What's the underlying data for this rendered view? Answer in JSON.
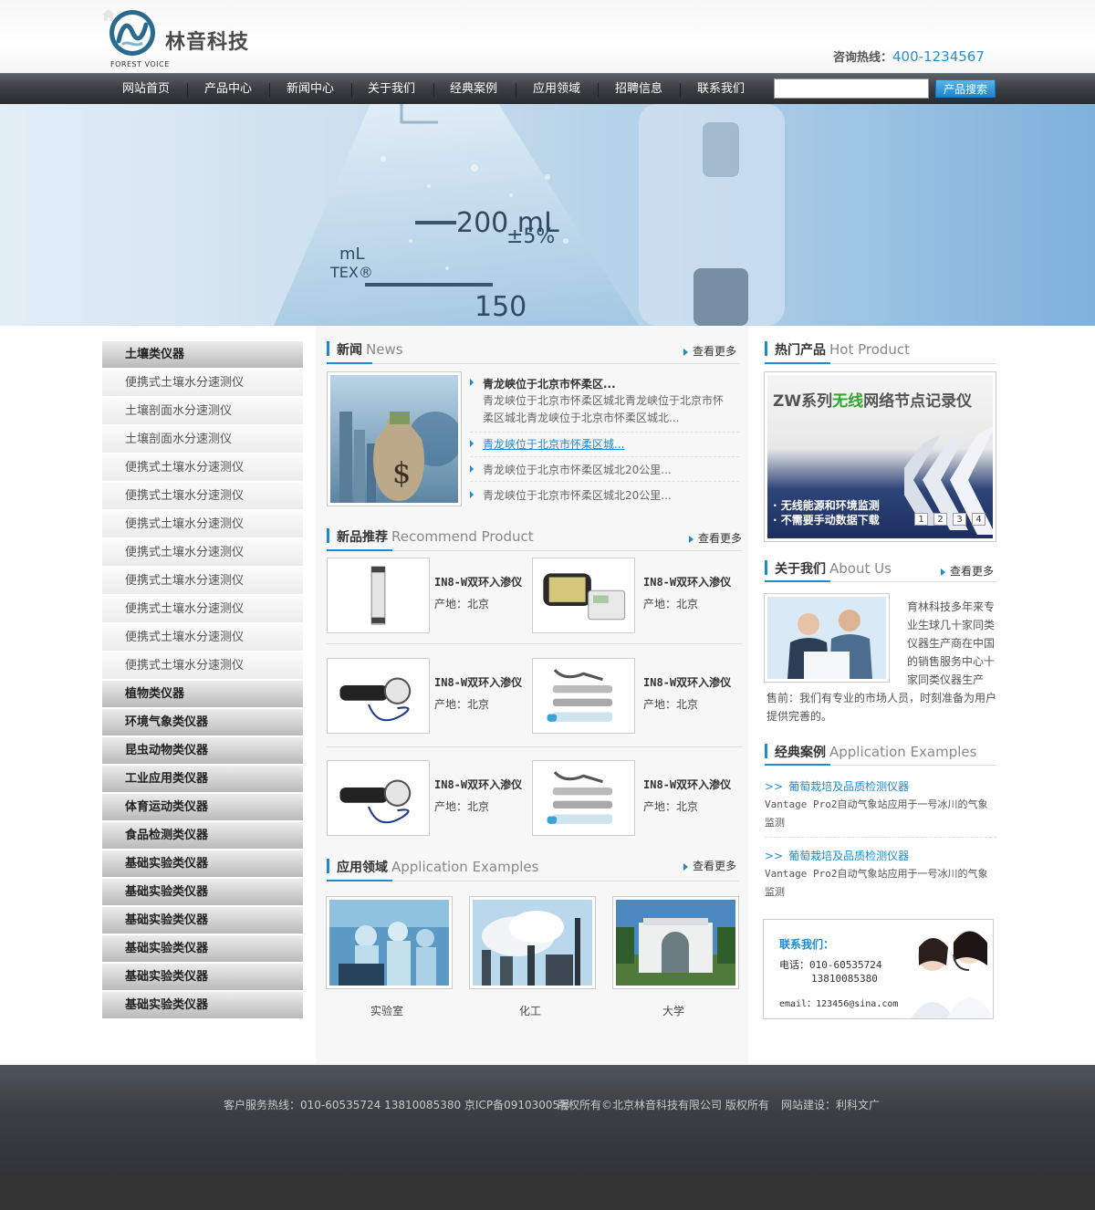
{
  "header": {
    "logo_text": "林音科技",
    "logo_sub": "FOREST VOICE",
    "hotline_label": "咨询热线：",
    "hotline_number": "400-1234567"
  },
  "nav": {
    "items": [
      "网站首页",
      "产品中心",
      "新闻中心",
      "关于我们",
      "经典案例",
      "应用领域",
      "招聘信息",
      "联系我们"
    ],
    "search_value": "",
    "search_button": "产品搜索"
  },
  "sidebar": {
    "categories": [
      {
        "label": "土壤类仪器",
        "type": "head"
      },
      {
        "label": "便携式土壤水分速测仪",
        "type": "sub"
      },
      {
        "label": "土壤剖面水分速测仪",
        "type": "sub"
      },
      {
        "label": "土壤剖面水分速测仪",
        "type": "sub"
      },
      {
        "label": "便携式土壤水分速测仪",
        "type": "sub"
      },
      {
        "label": "便携式土壤水分速测仪",
        "type": "sub"
      },
      {
        "label": "便携式土壤水分速测仪",
        "type": "sub"
      },
      {
        "label": "便携式土壤水分速测仪",
        "type": "sub"
      },
      {
        "label": "便携式土壤水分速测仪",
        "type": "sub"
      },
      {
        "label": "便携式土壤水分速测仪",
        "type": "sub"
      },
      {
        "label": "便携式土壤水分速测仪",
        "type": "sub"
      },
      {
        "label": "便携式土壤水分速测仪",
        "type": "sub"
      },
      {
        "label": "植物类仪器",
        "type": "head"
      },
      {
        "label": "环境气象类仪器",
        "type": "head"
      },
      {
        "label": "昆虫动物类仪器",
        "type": "head"
      },
      {
        "label": "工业应用类仪器",
        "type": "head"
      },
      {
        "label": "体育运动类仪器",
        "type": "head"
      },
      {
        "label": "食品检测类仪器",
        "type": "head"
      },
      {
        "label": "基础实验类仪器",
        "type": "head"
      },
      {
        "label": "基础实验类仪器",
        "type": "head"
      },
      {
        "label": "基础实验类仪器",
        "type": "head"
      },
      {
        "label": "基础实验类仪器",
        "type": "head"
      },
      {
        "label": "基础实验类仪器",
        "type": "head"
      },
      {
        "label": "基础实验类仪器",
        "type": "head"
      }
    ]
  },
  "news": {
    "title": "新闻",
    "title_en": "News",
    "more": "查看更多",
    "featured_title": "青龙峡位于北京市怀柔区...",
    "featured_desc": "青龙峡位于北京市怀柔区城北青龙峡位于北京市怀柔区城北青龙峡位于北京市怀柔区城北...",
    "items": [
      "青龙峡位于北京市怀柔区城...",
      "青龙峡位于北京市怀柔区城北20公里...",
      "青龙峡位于北京市怀柔区城北20公里..."
    ]
  },
  "recommend": {
    "title": "新品推荐",
    "title_en": "Recommend Product",
    "more": "查看更多",
    "products": [
      {
        "name": "IN8-W双环入渗仪",
        "origin": "产地：北京"
      },
      {
        "name": "IN8-W双环入渗仪",
        "origin": "产地：北京"
      },
      {
        "name": "IN8-W双环入渗仪",
        "origin": "产地：北京"
      },
      {
        "name": "IN8-W双环入渗仪",
        "origin": "产地：北京"
      },
      {
        "name": "IN8-W双环入渗仪",
        "origin": "产地：北京"
      },
      {
        "name": "IN8-W双环入渗仪",
        "origin": "产地：北京"
      }
    ]
  },
  "application": {
    "title": "应用领域",
    "title_en": "Application Examples",
    "more": "查看更多",
    "items": [
      "实验室",
      "化工",
      "大学"
    ]
  },
  "hot": {
    "title": "热门产品",
    "title_en": "Hot Product",
    "banner_title_pre": "ZW系列",
    "banner_title_hi": "无线",
    "banner_title_post": "网络节点记录仪",
    "banner_line1": "· 无线能源和环境监测",
    "banner_line2": "· 不需要手动数据下载",
    "pages": [
      "1",
      "2",
      "3",
      "4"
    ]
  },
  "about": {
    "title": "关于我们",
    "title_en": "About Us",
    "more": "查看更多",
    "text_right": "育林科技多年来专业生球几十家同类仪器生产商在中国的销售服务中心十家同类仪器生产",
    "text_full": "售前：我们有专业的市场人员，时刻准备为用户提供完善的。"
  },
  "cases": {
    "title": "经典案例",
    "title_en": "Application Examples",
    "items": [
      {
        "title": "葡萄栽培及品质检测仪器",
        "desc": "Vantage Pro2自动气象站应用于一号冰川的气象监测"
      },
      {
        "title": "葡萄栽培及品质检测仪器",
        "desc": "Vantage Pro2自动气象站应用于一号冰川的气象监测"
      }
    ]
  },
  "contact": {
    "title": "联系我们：",
    "phone_label": "电话：",
    "phone1": "010-60535724",
    "phone2": "13810085380",
    "email": "email：123456@sina.com"
  },
  "footer": {
    "service": "客户服务热线：010-60535724  13810085380  京ICP备09103005号",
    "copyright": "版权所有©北京林音科技有限公司 版权所有",
    "builder": "网站建设：利科文广"
  },
  "colors": {
    "accent": "#1a8bd6",
    "nav_bg": "#3a3d42",
    "footer_bg": "#3c4045"
  }
}
